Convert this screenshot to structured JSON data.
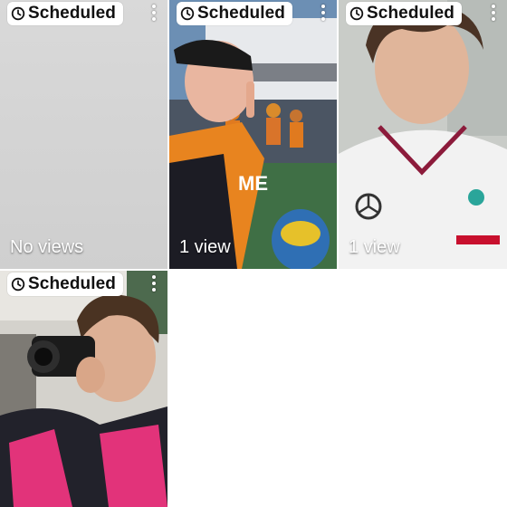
{
  "grid": {
    "tiles": [
      {
        "badge": "Scheduled",
        "views": "No views",
        "thumbnail": "gray-placeholder"
      },
      {
        "badge": "Scheduled",
        "views": "1 view",
        "thumbnail": "driver-orange-team-pointing",
        "caption": "ME"
      },
      {
        "badge": "Scheduled",
        "views": "1 view",
        "thumbnail": "young-man-mercedes-shirt"
      },
      {
        "badge": "Scheduled",
        "views": "",
        "thumbnail": "driver-with-camera"
      }
    ]
  },
  "icons": {
    "badge": "clock-icon",
    "menu": "more-vertical-icon"
  },
  "colors": {
    "badge_bg": "#ffffff",
    "badge_text": "#111111",
    "overlay_text": "#ffffff"
  }
}
